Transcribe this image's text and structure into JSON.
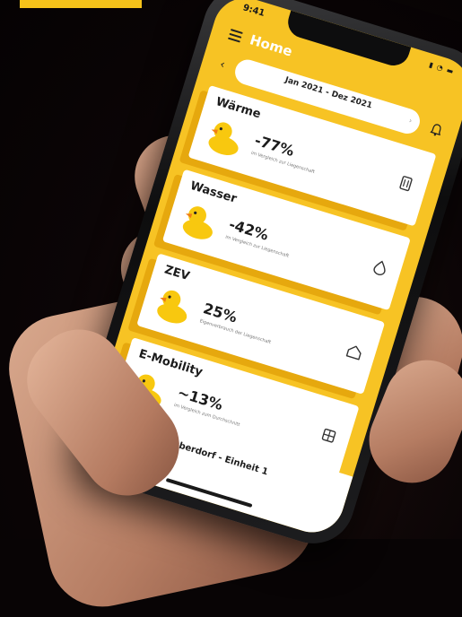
{
  "status": {
    "time": "9:41",
    "icons": "▮ ◔ ▬"
  },
  "header": {
    "title": "Home"
  },
  "date_selector": {
    "range": "Jan 2021 - Dez 2021",
    "subtitle": ""
  },
  "cards": [
    {
      "title": "Wärme",
      "value": "-77%",
      "subtitle": "im Vergleich zur Liegenschaft",
      "icon": "thermometer-icon"
    },
    {
      "title": "Wasser",
      "value": "-42%",
      "subtitle": "im Vergleich zur Liegenschaft",
      "icon": "water-drop-icon"
    },
    {
      "title": "ZEV",
      "value": "25%",
      "subtitle": "Eigenverbrauch der Liegenschaft",
      "icon": "house-icon"
    },
    {
      "title": "E-Mobility",
      "value": "~13%",
      "subtitle": "im Vergleich zum Durchschnitt",
      "icon": "charger-icon"
    }
  ],
  "footer": {
    "title": "Oberdorf - Einheit 1",
    "subtitle": ""
  },
  "colors": {
    "accent": "#f7c324",
    "card_shadow": "#e6a80e",
    "banner": "#f5c21a"
  }
}
